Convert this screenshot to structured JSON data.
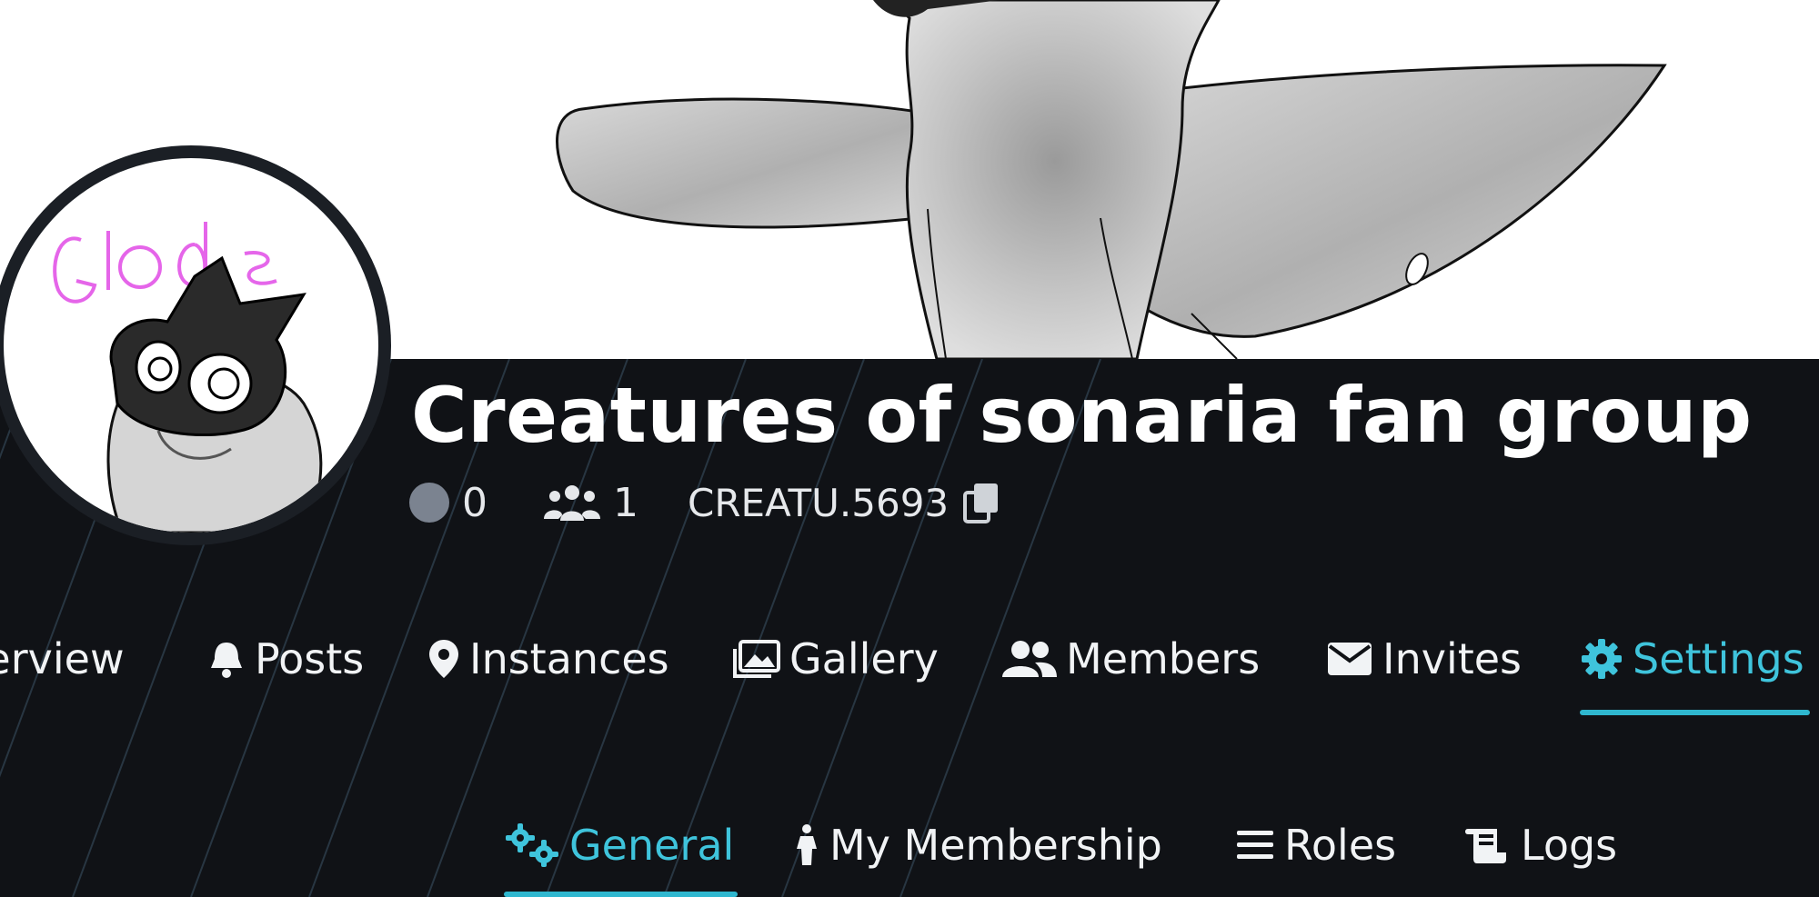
{
  "group": {
    "name": "Creatures of sonaria fan group",
    "online_count": "0",
    "member_count": "1",
    "short_code": "CREATU.5693"
  },
  "avatar": {
    "handwritten_text": "Glode"
  },
  "tabs": [
    {
      "label": "Overview",
      "icon": "home-icon",
      "active": false
    },
    {
      "label": "Posts",
      "icon": "bell-icon",
      "active": false
    },
    {
      "label": "Instances",
      "icon": "map-pin-icon",
      "active": false
    },
    {
      "label": "Gallery",
      "icon": "images-icon",
      "active": false
    },
    {
      "label": "Members",
      "icon": "users-icon",
      "active": false
    },
    {
      "label": "Invites",
      "icon": "envelope-icon",
      "active": false
    },
    {
      "label": "Settings",
      "icon": "gear-icon",
      "active": true
    }
  ],
  "settings_tabs": [
    {
      "label": "General",
      "icon": "gears-icon",
      "active": true
    },
    {
      "label": "My Membership",
      "icon": "person-icon",
      "active": false
    },
    {
      "label": "Roles",
      "icon": "bars-icon",
      "active": false
    },
    {
      "label": "Logs",
      "icon": "scroll-icon",
      "active": false
    }
  ],
  "colors": {
    "accent": "#3fc4dc",
    "background": "#101216",
    "stripe": "#2b3a47",
    "online_dot": "#7b8390"
  }
}
